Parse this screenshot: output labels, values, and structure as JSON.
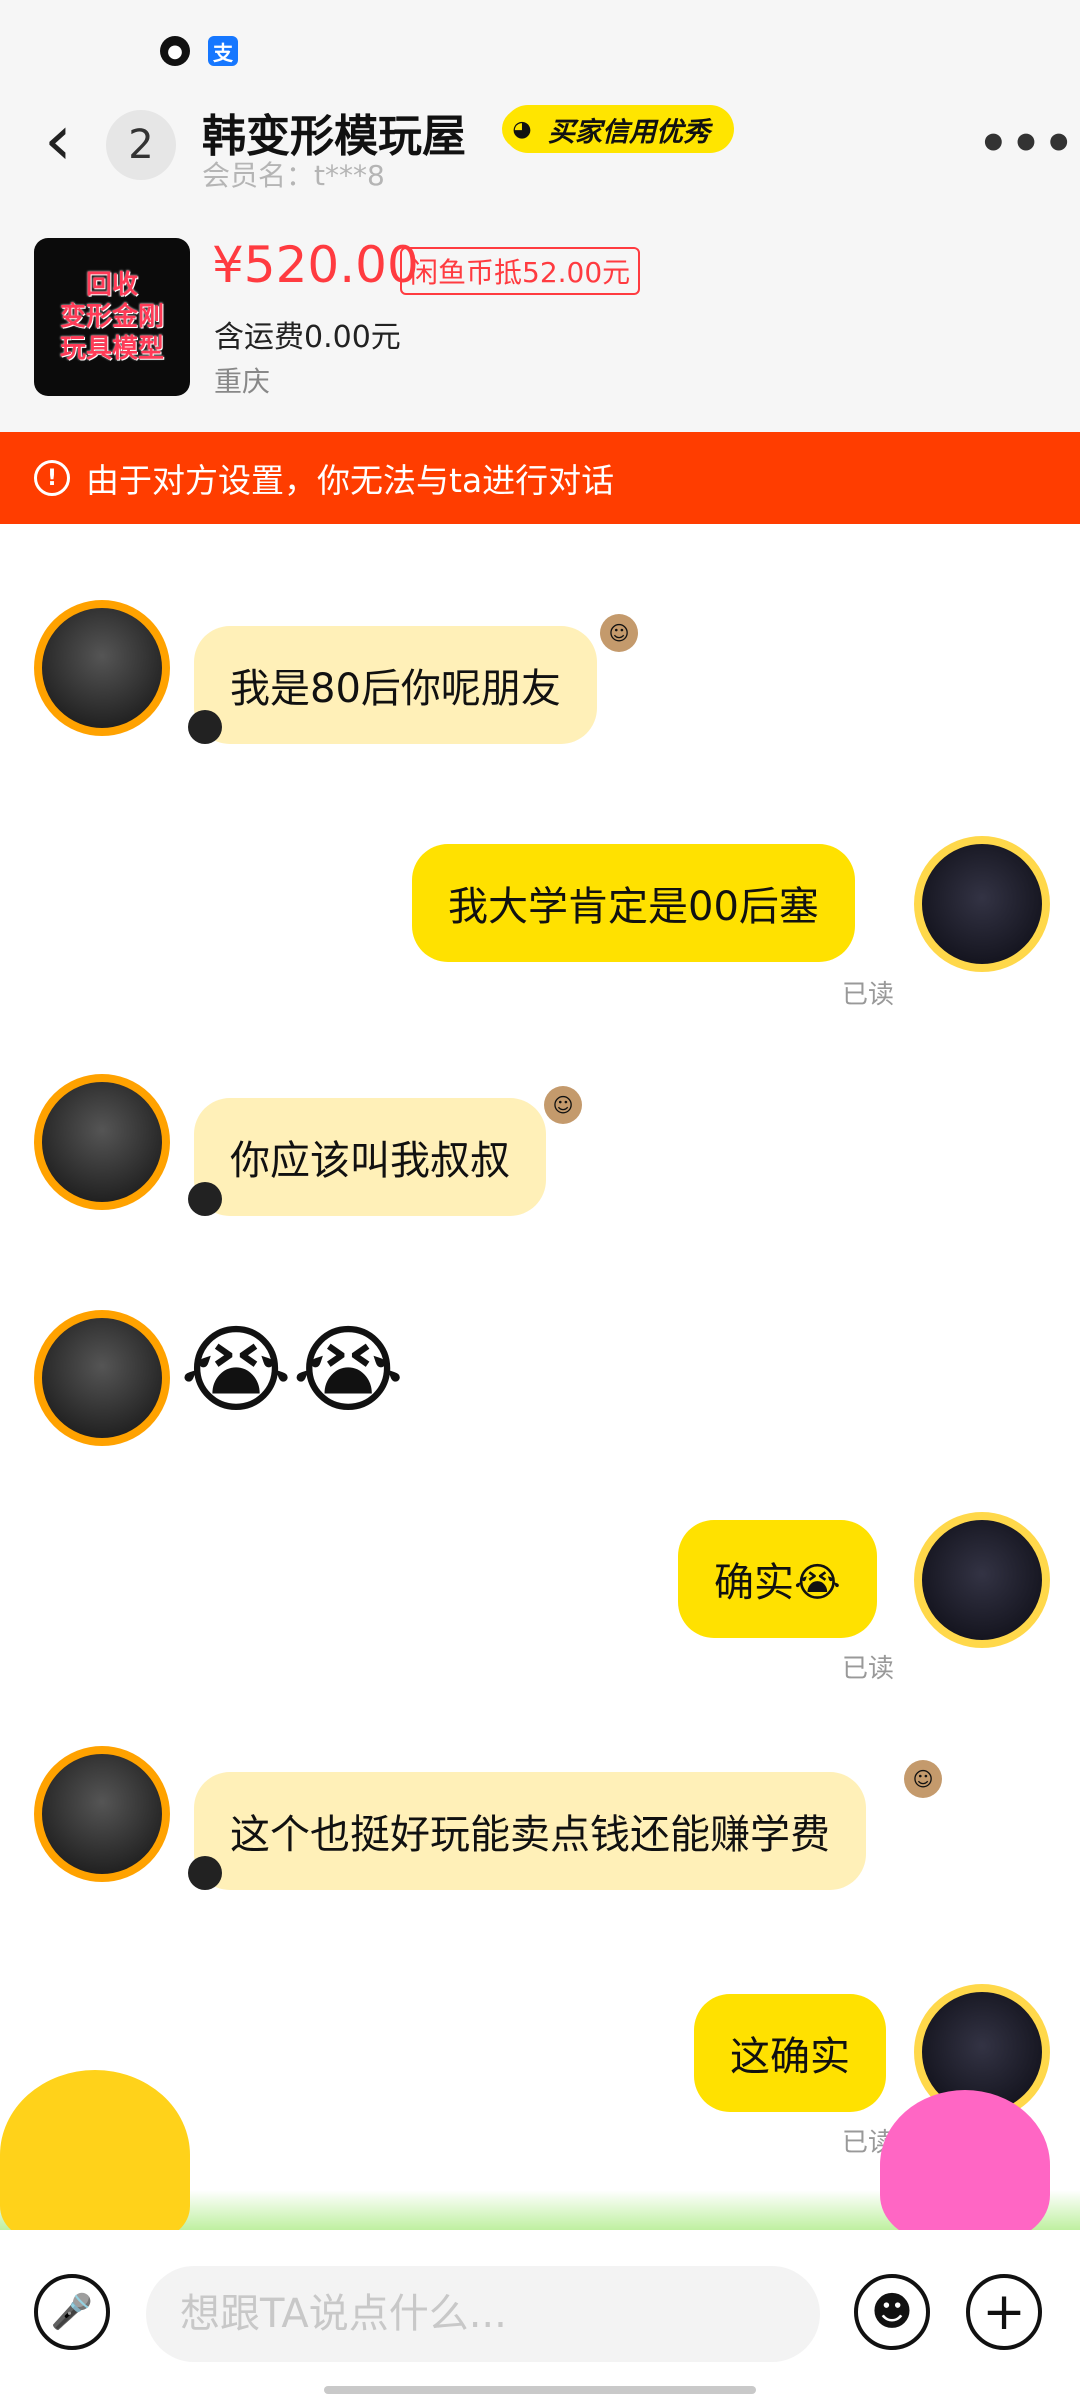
{
  "status": {
    "icons": [
      "qq-icon",
      "alipay-icon"
    ],
    "alipay_glyph": "支"
  },
  "header": {
    "back_glyph": "‹",
    "unread_count": "2",
    "shop_name": "韩变形模玩屋",
    "credit_badge": "买家信用优秀",
    "member_name": "会员名：t***8",
    "more_glyph": "•••"
  },
  "product": {
    "thumb_lines": [
      "回收",
      "变形金刚",
      "玩具模型"
    ],
    "price": "¥520.00",
    "coin_discount": "闲鱼币抵52.00元",
    "shipping": "含运费0.00元",
    "location": "重庆"
  },
  "banner": {
    "icon": "!",
    "text": "由于对方设置，你无法与ta进行对话"
  },
  "messages": [
    {
      "side": "in",
      "text": "我是80后你呢朋友"
    },
    {
      "side": "out",
      "text": "我大学肯定是00后塞",
      "status": "已读"
    },
    {
      "side": "in",
      "text": "你应该叫我叔叔"
    },
    {
      "side": "in",
      "text": "😭😭"
    },
    {
      "side": "out",
      "text": "确实😭",
      "status": "已读"
    },
    {
      "side": "in",
      "text": "这个也挺好玩能卖点钱还能赚学费"
    },
    {
      "side": "out",
      "text": "这确实",
      "status": "已读"
    }
  ],
  "input": {
    "placeholder": "想跟TA说点什么..."
  },
  "colors": {
    "accent": "#ffe100",
    "incoming_bubble": "#fff0b8",
    "banner": "#ff3d00",
    "price": "#ff3b40"
  }
}
